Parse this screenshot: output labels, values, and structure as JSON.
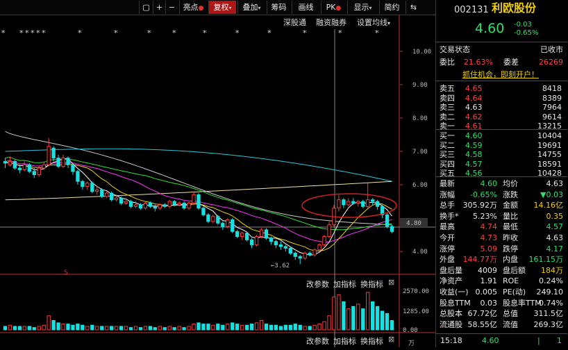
{
  "toolbar": {
    "buttons": [
      {
        "label": "▢",
        "name": "window-icon"
      },
      {
        "label": "+"
      },
      {
        "label": "−"
      },
      {
        "label": "亮点"
      },
      {
        "label": "复权"
      },
      {
        "label": "叠加"
      },
      {
        "label": "筹码"
      },
      {
        "label": "画线"
      },
      {
        "label": "PK"
      },
      {
        "label": "显示"
      },
      {
        "label": "简约"
      },
      {
        "label": "⇆"
      }
    ]
  },
  "chart": {
    "top_links": [
      "深股通",
      "融资融券",
      "设置均线"
    ],
    "price_axis": [
      "10.00",
      "9.00",
      "8.00",
      "7.00",
      "6.00",
      "5.00",
      "4.00"
    ],
    "current_price_tag": "4.80",
    "low_annotation": "←3.62",
    "star_marker": "*",
    "s_marker": "S",
    "volume_axis": [
      "2570.00",
      "1285.00",
      "0.00"
    ],
    "volume_unit": "万",
    "sub_buttons_1": [
      "改参数",
      "加指标",
      "换指标"
    ],
    "sub_buttons_2": [
      "改参数",
      "加指标",
      "换指标"
    ],
    "close_label": "⊠",
    "colors": {
      "up": "#ff3b3b",
      "down": "#19e0e0",
      "ma5": "#ffffff",
      "ma10": "#f0d000",
      "ma20": "#ff30ff",
      "ma30": "#30e030",
      "ma60": "#c8c8c8",
      "ma120": "#2ac8d8",
      "ma250": "#f0e0a0",
      "circle": "#d02020"
    }
  },
  "chart_data": {
    "type": "candlestick",
    "ylim": [
      3.4,
      10.6
    ],
    "candles": [
      [
        6.7,
        6.65,
        6.8,
        6.5
      ],
      [
        6.6,
        6.7,
        6.85,
        6.55
      ],
      [
        6.7,
        6.5,
        6.75,
        6.45
      ],
      [
        6.5,
        6.45,
        6.6,
        6.35
      ],
      [
        6.45,
        6.6,
        6.7,
        6.4
      ],
      [
        6.6,
        6.4,
        6.65,
        6.35
      ],
      [
        6.4,
        6.3,
        6.5,
        6.2
      ],
      [
        6.3,
        6.5,
        6.55,
        6.25
      ],
      [
        6.5,
        6.6,
        6.7,
        6.45
      ],
      [
        6.6,
        7.15,
        7.4,
        6.55
      ],
      [
        7.1,
        6.8,
        7.15,
        6.7
      ],
      [
        6.8,
        6.55,
        6.9,
        6.5
      ],
      [
        6.55,
        6.8,
        6.9,
        6.5
      ],
      [
        6.8,
        6.6,
        6.85,
        6.5
      ],
      [
        6.6,
        6.4,
        6.65,
        6.3
      ],
      [
        6.4,
        6.1,
        6.45,
        6.0
      ],
      [
        6.1,
        5.95,
        6.15,
        5.85
      ],
      [
        5.95,
        6.05,
        6.1,
        5.85
      ],
      [
        6.05,
        5.8,
        6.1,
        5.75
      ],
      [
        5.8,
        5.85,
        5.95,
        5.7
      ],
      [
        5.85,
        5.65,
        5.9,
        5.6
      ],
      [
        5.65,
        5.75,
        5.8,
        5.6
      ],
      [
        5.75,
        5.55,
        5.8,
        5.5
      ],
      [
        5.55,
        5.6,
        5.7,
        5.5
      ],
      [
        5.6,
        5.45,
        5.65,
        5.4
      ],
      [
        5.45,
        5.5,
        5.6,
        5.4
      ],
      [
        5.5,
        5.35,
        5.55,
        5.3
      ],
      [
        5.35,
        5.4,
        5.5,
        5.3
      ],
      [
        5.4,
        5.3,
        5.45,
        5.25
      ],
      [
        5.3,
        5.45,
        5.5,
        5.25
      ],
      [
        5.45,
        5.35,
        5.5,
        5.3
      ],
      [
        5.35,
        5.3,
        5.4,
        5.2
      ],
      [
        5.3,
        5.4,
        5.45,
        5.25
      ],
      [
        5.4,
        5.35,
        5.45,
        5.3
      ],
      [
        5.35,
        5.5,
        5.55,
        5.3
      ],
      [
        5.5,
        5.4,
        5.55,
        5.35
      ],
      [
        5.4,
        5.45,
        5.5,
        5.35
      ],
      [
        5.45,
        5.3,
        5.5,
        5.25
      ],
      [
        5.3,
        5.45,
        5.5,
        5.25
      ],
      [
        5.45,
        5.7,
        5.8,
        5.4
      ],
      [
        5.7,
        5.3,
        5.75,
        5.25
      ],
      [
        5.3,
        5.1,
        5.35,
        5.05
      ],
      [
        5.1,
        4.9,
        5.15,
        4.85
      ],
      [
        4.9,
        5.05,
        5.1,
        4.85
      ],
      [
        5.05,
        4.85,
        5.1,
        4.8
      ],
      [
        4.85,
        4.75,
        4.9,
        4.65
      ],
      [
        4.75,
        4.95,
        5.0,
        4.7
      ],
      [
        4.95,
        4.6,
        5.0,
        4.55
      ],
      [
        4.6,
        4.45,
        4.65,
        4.4
      ],
      [
        4.45,
        4.55,
        4.6,
        4.35
      ],
      [
        4.55,
        4.35,
        4.6,
        4.3
      ],
      [
        4.35,
        4.2,
        4.4,
        4.1
      ],
      [
        4.2,
        4.45,
        4.5,
        4.15
      ],
      [
        4.45,
        4.65,
        4.7,
        4.4
      ],
      [
        4.65,
        4.4,
        4.7,
        4.35
      ],
      [
        4.4,
        4.3,
        4.45,
        4.2
      ],
      [
        4.3,
        4.2,
        4.35,
        4.1
      ],
      [
        4.2,
        4.15,
        4.3,
        4.05
      ],
      [
        4.15,
        4.1,
        4.2,
        4.0
      ],
      [
        4.1,
        3.95,
        4.15,
        3.9
      ],
      [
        3.95,
        3.85,
        4.0,
        3.75
      ],
      [
        3.85,
        3.8,
        3.9,
        3.62
      ],
      [
        3.8,
        3.95,
        4.0,
        3.75
      ],
      [
        3.95,
        3.9,
        4.0,
        3.85
      ],
      [
        3.9,
        4.05,
        4.1,
        3.85
      ],
      [
        4.05,
        4.2,
        4.25,
        4.0
      ],
      [
        4.2,
        4.45,
        4.5,
        4.15
      ],
      [
        4.45,
        4.8,
        4.9,
        4.4
      ],
      [
        4.8,
        5.3,
        5.4,
        4.75
      ],
      [
        5.3,
        5.55,
        5.7,
        5.2
      ],
      [
        5.55,
        5.4,
        5.6,
        5.3
      ],
      [
        5.4,
        5.5,
        5.6,
        5.35
      ],
      [
        5.5,
        5.45,
        5.6,
        5.4
      ],
      [
        5.45,
        5.5,
        5.55,
        5.35
      ],
      [
        5.5,
        5.35,
        5.55,
        5.3
      ],
      [
        5.35,
        5.55,
        6.05,
        5.3
      ],
      [
        5.55,
        5.5,
        5.6,
        5.4
      ],
      [
        5.5,
        5.35,
        5.55,
        5.25
      ],
      [
        5.35,
        5.1,
        5.4,
        5.0
      ],
      [
        5.1,
        4.75,
        5.15,
        4.7
      ],
      [
        4.75,
        4.6,
        4.8,
        4.55
      ]
    ],
    "volumes": [
      3,
      4,
      3,
      3,
      3,
      3,
      2,
      3,
      4,
      12,
      8,
      6,
      5,
      5,
      4,
      5,
      4,
      3,
      4,
      3,
      3,
      3,
      3,
      3,
      3,
      3,
      2,
      3,
      2,
      3,
      3,
      2,
      3,
      2,
      3,
      2,
      3,
      2,
      3,
      5,
      6,
      5,
      5,
      4,
      5,
      4,
      5,
      6,
      5,
      4,
      4,
      5,
      6,
      8,
      5,
      4,
      4,
      3,
      4,
      4,
      5,
      4,
      3,
      3,
      4,
      5,
      7,
      12,
      28,
      30,
      24,
      18,
      20,
      22,
      18,
      32,
      24,
      20,
      16,
      14,
      8
    ],
    "volume_ylim": [
      0,
      2570
    ]
  },
  "panel": {
    "code": "002131",
    "name": "利欧股份",
    "price": "4.60",
    "change": "-0.03",
    "change_pct": "-0.65%",
    "status_label": "交易状态",
    "status_value": "已收市",
    "webi_label": "委比",
    "webi_value": "21.63%",
    "weicha_label": "委差",
    "weicha_value": "26269",
    "promo": "抓住机会，即刻开户！",
    "sells": [
      {
        "label": "卖五",
        "price": "4.65",
        "vol": "8418"
      },
      {
        "label": "卖四",
        "price": "4.64",
        "vol": "8389"
      },
      {
        "label": "卖三",
        "price": "4.63",
        "vol": "7964"
      },
      {
        "label": "卖二",
        "price": "4.62",
        "vol": "9614"
      },
      {
        "label": "卖一",
        "price": "4.61",
        "vol": "13215"
      }
    ],
    "buys": [
      {
        "label": "买一",
        "price": "4.60",
        "vol": "10404"
      },
      {
        "label": "买二",
        "price": "4.59",
        "vol": "19691"
      },
      {
        "label": "买三",
        "price": "4.58",
        "vol": "14755"
      },
      {
        "label": "买四",
        "price": "4.57",
        "vol": "18591"
      },
      {
        "label": "买五",
        "price": "4.56",
        "vol": "10428"
      }
    ],
    "stats": [
      {
        "l1": "最新",
        "v1": "4.60",
        "c1": "green",
        "l2": "均价",
        "v2": "4.63",
        "c2": "white"
      },
      {
        "l1": "涨幅",
        "v1": "-0.65%",
        "c1": "green",
        "l2": "涨跌",
        "v2": "▼0.03",
        "c2": "green"
      },
      {
        "l1": "总手",
        "v1": "305.92万",
        "c1": "white",
        "l2": "金额",
        "v2": "14.16亿",
        "c2": "yellow"
      },
      {
        "l1": "换手*",
        "v1": "5.23%",
        "c1": "white",
        "l2": "量比",
        "v2": "0.35",
        "c2": "yellow"
      },
      {
        "l1": "最高",
        "v1": "4.74",
        "c1": "red",
        "l2": "最低",
        "v2": "4.57",
        "c2": "green"
      },
      {
        "l1": "今开",
        "v1": "4.73",
        "c1": "red",
        "l2": "昨收",
        "v2": "4.63",
        "c2": "white"
      },
      {
        "l1": "涨停",
        "v1": "5.09",
        "c1": "red",
        "l2": "跌停",
        "v2": "4.17",
        "c2": "green"
      },
      {
        "l1": "外盘",
        "v1": "144.77万",
        "c1": "red",
        "l2": "内盘",
        "v2": "161.15万",
        "c2": "green"
      },
      {
        "l1": "盘后量",
        "v1": "4009",
        "c1": "white",
        "l2": "盘后额",
        "v2": "184万",
        "c2": "yellow"
      },
      {
        "l1": "净资产",
        "v1": "1.91",
        "c1": "white",
        "l2": "ROE",
        "v2": "0.24%",
        "c2": "white"
      },
      {
        "l1": "收益(一)",
        "v1": "0.005",
        "c1": "white",
        "l2": "PE(动)",
        "v2": "249.10",
        "c2": "white"
      },
      {
        "l1": "股息TTM",
        "v1": "0.03",
        "c1": "white",
        "l2": "股息率TTM",
        "v2": "0.74%",
        "c2": "white"
      },
      {
        "l1": "总股本",
        "v1": "67.72亿",
        "c1": "white",
        "l2": "总值",
        "v2": "311.5亿",
        "c2": "white"
      },
      {
        "l1": "流通股",
        "v1": "58.55亿",
        "c1": "white",
        "l2": "流值",
        "v2": "269.3亿",
        "c2": "white"
      }
    ],
    "tick": {
      "time": "15:18",
      "price": "4.60",
      "mark": "|",
      "count": "1"
    }
  }
}
